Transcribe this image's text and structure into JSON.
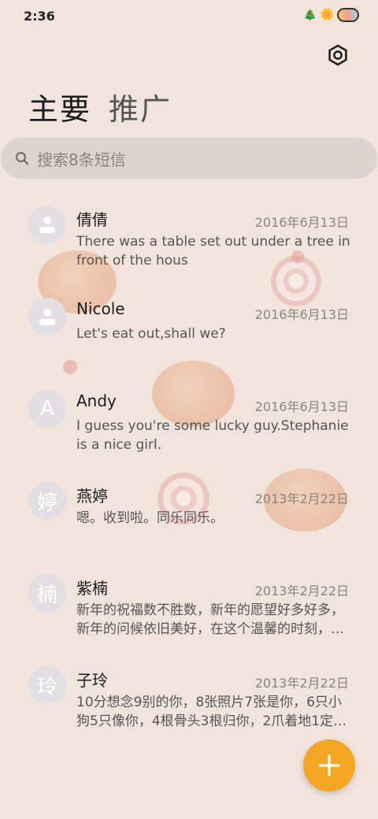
{
  "status_bar": {
    "time": "2:36"
  },
  "tabs": [
    {
      "label": "主要",
      "active": true
    },
    {
      "label": "推广",
      "active": false
    }
  ],
  "search": {
    "placeholder": "搜索8条短信"
  },
  "conversations": [
    {
      "name": "倩倩",
      "date": "2016年6月13日",
      "message": "There was a table set out under a tree in front of the hous",
      "avatar": ""
    },
    {
      "name": "Nicole",
      "date": "2016年6月13日",
      "message": "Let's eat out,shall we?",
      "avatar": ""
    },
    {
      "name": "Andy",
      "date": "2016年6月13日",
      "message": "I guess you're some lucky guy.Stephanie is a nice girl.",
      "avatar": "A"
    },
    {
      "name": "燕婷",
      "date": "2013年2月22日",
      "message": "嗯。收到啦。同乐同乐。",
      "avatar": "婷"
    },
    {
      "name": "紫楠",
      "date": "2013年2月22日",
      "message": "新年的祝福数不胜数，新年的愿望好多好多，新年的问候依旧美好，在这个温馨的时刻，…",
      "avatar": "楠"
    },
    {
      "name": "子玲",
      "date": "2013年2月22日",
      "message": "10分想念9别的你，8张照片7张是你，6只小狗5只像你，4根骨头3根归你，2爪着地1定…",
      "avatar": "玲"
    }
  ],
  "colors": {
    "accent": "#f5a623",
    "background": "#f0e4dd"
  }
}
